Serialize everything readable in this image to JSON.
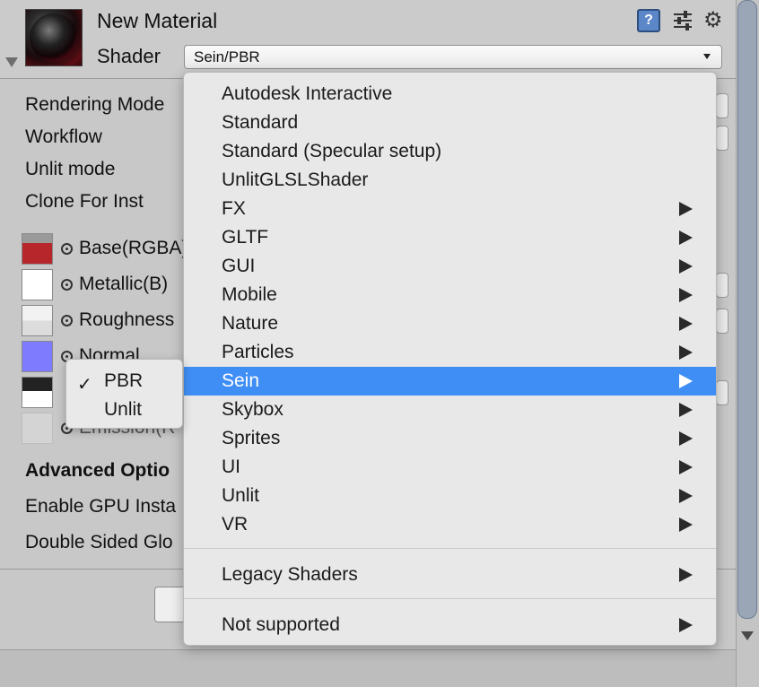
{
  "header": {
    "title": "New Material",
    "shader_label": "Shader",
    "shader_value": "Sein/PBR",
    "help_glyph": "?"
  },
  "properties": {
    "rendering_mode": "Rendering Mode",
    "workflow": "Workflow",
    "unlit_mode": "Unlit mode",
    "clone_for_inst": "Clone For Inst",
    "base": "Base(RGBA)",
    "metallic": "Metallic(B)",
    "roughness": "Roughness",
    "normal": "Normal",
    "emission": "Emission(R",
    "advanced": "Advanced Optio",
    "gpu_instancing": "Enable GPU Insta",
    "double_sided": "Double Sided Glo"
  },
  "shader_menu": {
    "items": [
      {
        "label": "Autodesk Interactive",
        "submenu": false
      },
      {
        "label": "Standard",
        "submenu": false
      },
      {
        "label": "Standard (Specular setup)",
        "submenu": false
      },
      {
        "label": "UnlitGLSLShader",
        "submenu": false
      },
      {
        "label": "FX",
        "submenu": true
      },
      {
        "label": "GLTF",
        "submenu": true
      },
      {
        "label": "GUI",
        "submenu": true
      },
      {
        "label": "Mobile",
        "submenu": true
      },
      {
        "label": "Nature",
        "submenu": true
      },
      {
        "label": "Particles",
        "submenu": true
      },
      {
        "label": "Sein",
        "submenu": true,
        "selected": true
      },
      {
        "label": "Skybox",
        "submenu": true
      },
      {
        "label": "Sprites",
        "submenu": true
      },
      {
        "label": "UI",
        "submenu": true
      },
      {
        "label": "Unlit",
        "submenu": true
      },
      {
        "label": "VR",
        "submenu": true
      }
    ],
    "legacy": "Legacy Shaders",
    "not_supported": "Not supported"
  },
  "mode_popup": {
    "check": "✓",
    "items": [
      "PBR",
      "Unlit"
    ],
    "selected": "PBR"
  },
  "colors": {
    "selection": "#3f8ef5",
    "normal_map": "#7f7bff"
  }
}
